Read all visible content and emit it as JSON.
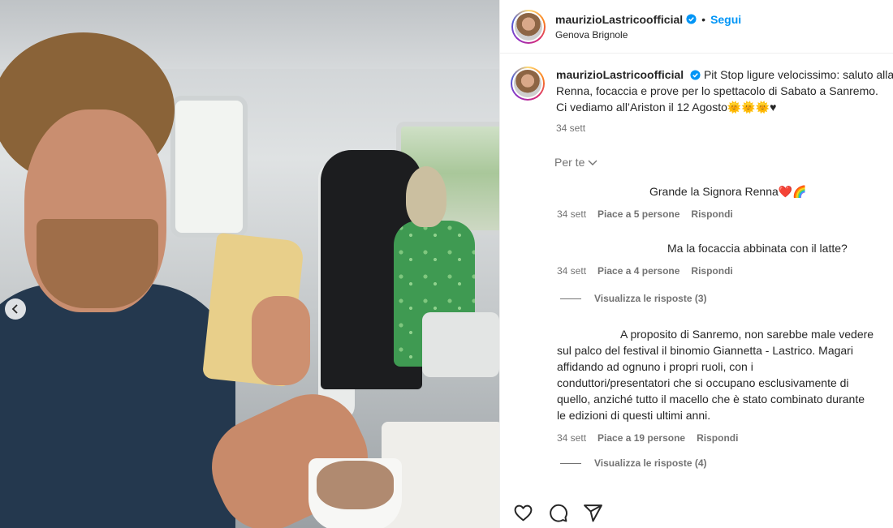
{
  "post": {
    "username": "maurizioLastricoofficial",
    "follow_label": "Segui",
    "separator": "•",
    "location": "Genova Brignole"
  },
  "caption": {
    "username": "maurizioLastricoofficial",
    "lines": [
      "Pit Stop ligure velocissimo: saluto alla",
      "Renna, focaccia e prove per lo spettacolo di Sabato a Sanremo.",
      "Ci vediamo all’Ariston il 12 Agosto🌞🌞🌞♥"
    ],
    "time": "34 sett"
  },
  "sort_label": "Per te",
  "comments": [
    {
      "text": "Grande la Signora Renna❤️🌈",
      "time": "34 sett",
      "likes": "Piace a 5 persone",
      "reply": "Rispondi"
    },
    {
      "text": "Ma la focaccia abbinata con il latte?",
      "time": "34 sett",
      "likes": "Piace a 4 persone",
      "reply": "Rispondi",
      "view_replies": "Visualizza le risposte (3)"
    },
    {
      "lines": [
        "A proposito di Sanremo, non sarebbe male vedere",
        "sul palco del festival il binomio Giannetta - Lastrico. Magari",
        "affidando ad ognuno i propri ruoli, con i",
        "conduttori/presentatori che si occupano esclusivamente di",
        "quello, anziché tutto il macello che è stato combinato durante",
        "le edizioni di questi ultimi anni."
      ],
      "time": "34 sett",
      "likes": "Piace a 19 persone",
      "reply": "Rispondi",
      "view_replies": "Visualizza le risposte (4)"
    }
  ],
  "icons": [
    "heart-icon",
    "comment-icon",
    "share-icon",
    "verified-icon",
    "chevron-left-icon",
    "chevron-down-icon"
  ],
  "colors": {
    "accent": "#0095f6",
    "secondary_text": "#737373"
  }
}
